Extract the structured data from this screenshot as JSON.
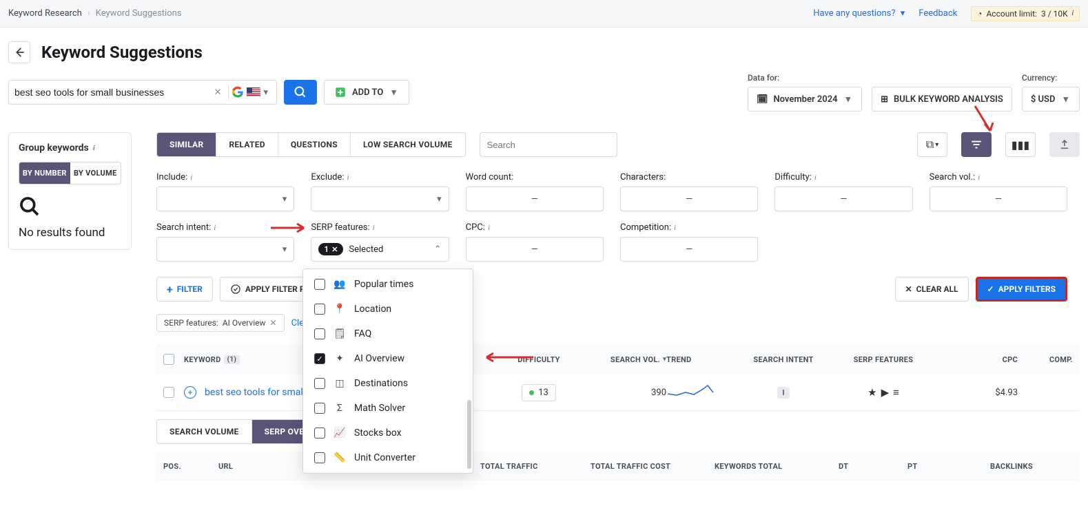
{
  "breadcrumb": {
    "root": "Keyword Research",
    "current": "Keyword Suggestions"
  },
  "topbar": {
    "questions": "Have any questions?",
    "feedback": "Feedback",
    "account_label": "Account limit:",
    "account_value": "3 / 10K"
  },
  "header": {
    "title": "Keyword Suggestions"
  },
  "search": {
    "query": "best seo tools for small businesses"
  },
  "addto": {
    "label": "ADD TO"
  },
  "datafor": {
    "label": "Data for:",
    "value": "November 2024"
  },
  "bulk": {
    "label": "BULK KEYWORD ANALYSIS"
  },
  "currency": {
    "label": "Currency:",
    "value": "$ USD"
  },
  "sidebar": {
    "title": "Group keywords",
    "by_number": "BY NUMBER",
    "by_volume": "BY VOLUME",
    "no_results": "No results found"
  },
  "tabs": {
    "similar": "SIMILAR",
    "related": "RELATED",
    "questions": "QUESTIONS",
    "low": "LOW SEARCH VOLUME"
  },
  "searchbox": {
    "placeholder": "Search"
  },
  "filters": {
    "include": "Include:",
    "exclude": "Exclude:",
    "wordcount": "Word count:",
    "characters": "Characters:",
    "difficulty": "Difficulty:",
    "searchvol": "Search vol.:",
    "intent": "Search intent:",
    "serp": "SERP features:",
    "cpc": "CPC:",
    "competition": "Competition:",
    "selected_label": "Selected",
    "selected_count": "1"
  },
  "actions": {
    "filter": "FILTER",
    "preset": "APPLY FILTER PRESET",
    "clear_all": "CLEAR ALL",
    "apply": "APPLY FILTERS"
  },
  "applied": {
    "label": "SERP features:",
    "value": "AI Overview",
    "clear": "Clear all filters"
  },
  "table": {
    "h_keyword": "KEYWORD",
    "h_count": "(1)",
    "h_diff": "DIFFICULTY",
    "h_vol": "SEARCH VOL.",
    "h_trend": "TREND",
    "h_intent": "SEARCH INTENT",
    "h_serp": "SERP FEATURES",
    "h_cpc": "CPC",
    "h_comp": "COMP.",
    "row": {
      "keyword": "best seo tools for small businesses",
      "difficulty": "13",
      "volume": "390",
      "intent": "I",
      "cpc": "$4.93"
    }
  },
  "subtabs": {
    "vol": "SEARCH VOLUME",
    "overview": "SERP OVERVIEW"
  },
  "lower": {
    "pos": "POS.",
    "url": "URL",
    "traffic": "TOTAL TRAFFIC",
    "cost": "TOTAL TRAFFIC COST",
    "kwtotal": "KEYWORDS TOTAL",
    "dt": "DT",
    "pt": "PT",
    "backl": "BACKLINKS"
  },
  "dropdown": {
    "items": [
      {
        "icon": "group",
        "label": "Popular times"
      },
      {
        "icon": "pin",
        "label": "Location"
      },
      {
        "icon": "faq",
        "label": "FAQ"
      },
      {
        "icon": "sparkle",
        "label": "AI Overview",
        "checked": true
      },
      {
        "icon": "dest",
        "label": "Destinations"
      },
      {
        "icon": "sigma",
        "label": "Math Solver"
      },
      {
        "icon": "stocks",
        "label": "Stocks box"
      },
      {
        "icon": "conv",
        "label": "Unit Converter"
      }
    ]
  }
}
